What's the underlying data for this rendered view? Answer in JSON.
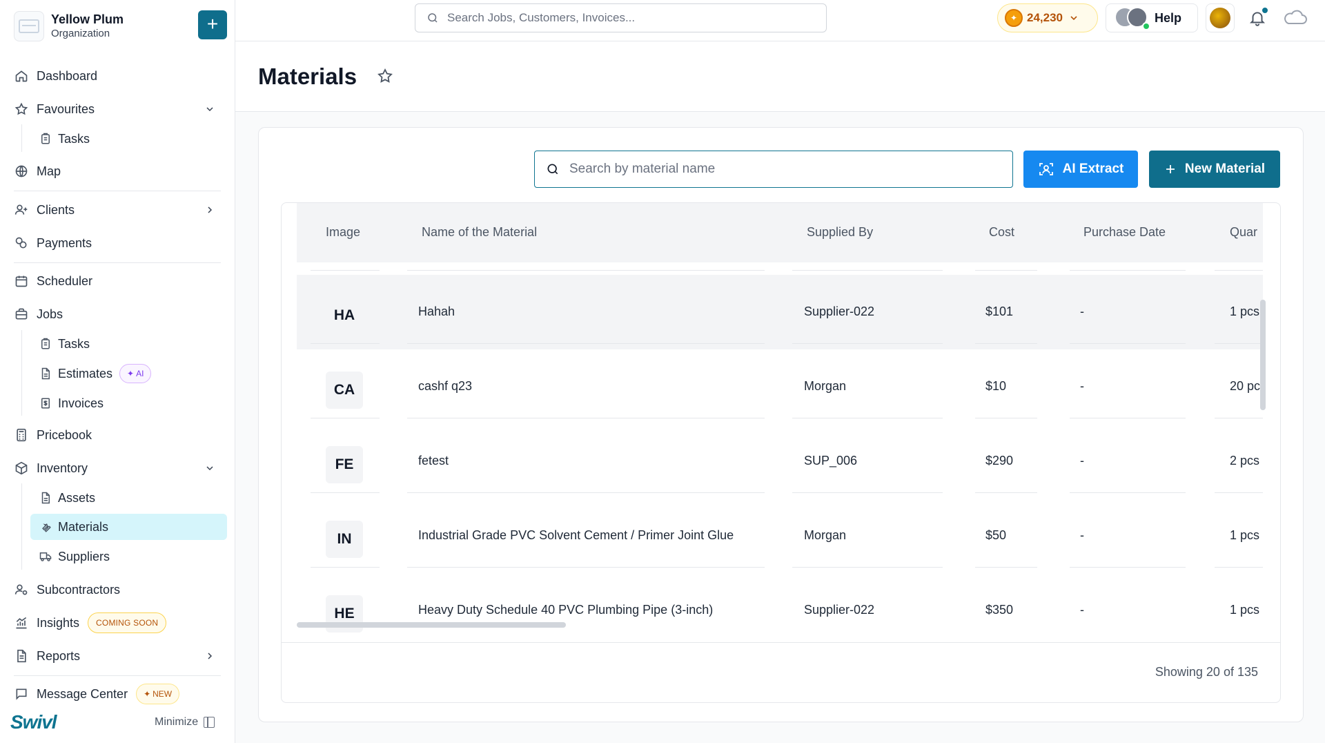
{
  "org": {
    "name": "Yellow Plum",
    "subtitle": "Organization"
  },
  "sidebar": {
    "items": [
      {
        "label": "Dashboard"
      },
      {
        "label": "Favourites"
      },
      {
        "label": "Tasks"
      },
      {
        "label": "Map"
      },
      {
        "label": "Clients"
      },
      {
        "label": "Payments"
      },
      {
        "label": "Scheduler"
      },
      {
        "label": "Jobs"
      },
      {
        "label": "Tasks"
      },
      {
        "label": "Estimates",
        "badge": "AI"
      },
      {
        "label": "Invoices"
      },
      {
        "label": "Pricebook"
      },
      {
        "label": "Inventory"
      },
      {
        "label": "Assets"
      },
      {
        "label": "Materials"
      },
      {
        "label": "Suppliers"
      },
      {
        "label": "Subcontractors"
      },
      {
        "label": "Insights",
        "badge": "COMING SOON"
      },
      {
        "label": "Reports"
      },
      {
        "label": "Message Center",
        "badge": "NEW"
      }
    ],
    "brand": "Swivl",
    "minimize": "Minimize"
  },
  "topbar": {
    "search_placeholder": "Search Jobs, Customers, Invoices...",
    "coins": "24,230",
    "help": "Help"
  },
  "page": {
    "title": "Materials"
  },
  "toolbar": {
    "search_placeholder": "Search by material name",
    "ai_extract": "AI Extract",
    "new_material": "New Material"
  },
  "table": {
    "columns": [
      "Image",
      "Name of the Material",
      "Supplied By",
      "Cost",
      "Purchase Date",
      "Quar"
    ],
    "rows": [
      {
        "initials": "HA",
        "name": "Hahah",
        "supplier": "Supplier-022",
        "cost": "$101",
        "date": "-",
        "qty": "1 pcs"
      },
      {
        "initials": "CA",
        "name": "cashf q23",
        "supplier": "Morgan",
        "cost": "$10",
        "date": "-",
        "qty": "20 pc"
      },
      {
        "initials": "FE",
        "name": "fetest",
        "supplier": "SUP_006",
        "cost": "$290",
        "date": "-",
        "qty": "2 pcs"
      },
      {
        "initials": "IN",
        "name": "Industrial Grade PVC Solvent Cement / Primer Joint Glue",
        "supplier": "Morgan",
        "cost": "$50",
        "date": "-",
        "qty": "1 pcs"
      },
      {
        "initials": "HE",
        "name": "Heavy Duty Schedule 40 PVC Plumbing Pipe (3-inch)",
        "supplier": "Supplier-022",
        "cost": "$350",
        "date": "-",
        "qty": "1 pcs"
      }
    ],
    "footer": "Showing 20 of 135"
  },
  "colors": {
    "primary": "#0f6e8c",
    "ai_button": "#1689f0",
    "active_nav": "#d5f5fb"
  }
}
